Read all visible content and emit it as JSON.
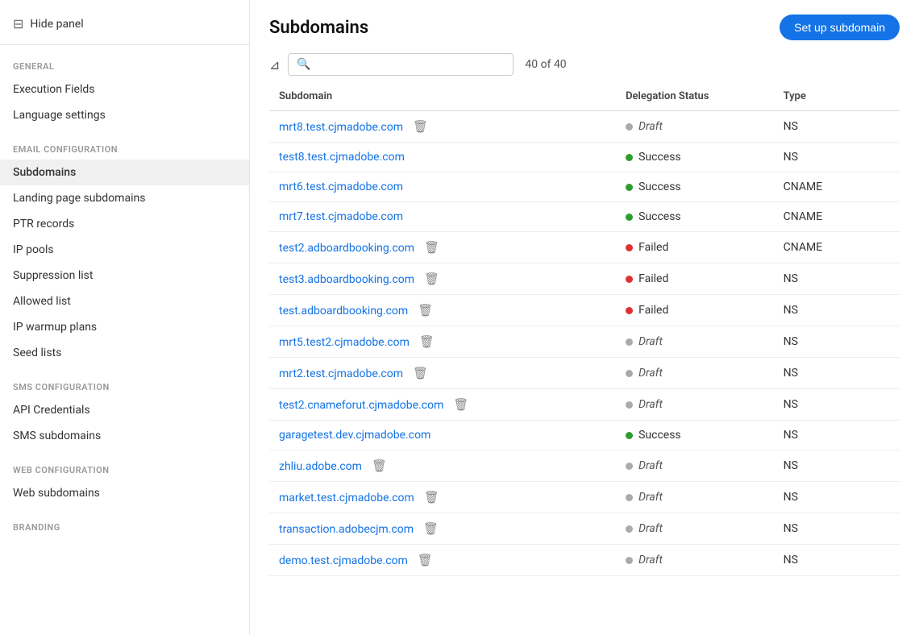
{
  "sidebar": {
    "hide_panel_label": "Hide panel",
    "sections": [
      {
        "label": "GENERAL",
        "items": [
          {
            "id": "execution-fields",
            "label": "Execution Fields",
            "active": false
          },
          {
            "id": "language-settings",
            "label": "Language settings",
            "active": false
          }
        ]
      },
      {
        "label": "EMAIL CONFIGURATION",
        "items": [
          {
            "id": "subdomains",
            "label": "Subdomains",
            "active": true
          },
          {
            "id": "landing-page-subdomains",
            "label": "Landing page subdomains",
            "active": false
          },
          {
            "id": "ptr-records",
            "label": "PTR records",
            "active": false
          },
          {
            "id": "ip-pools",
            "label": "IP pools",
            "active": false
          },
          {
            "id": "suppression-list",
            "label": "Suppression list",
            "active": false
          },
          {
            "id": "allowed-list",
            "label": "Allowed list",
            "active": false
          },
          {
            "id": "ip-warmup-plans",
            "label": "IP warmup plans",
            "active": false
          },
          {
            "id": "seed-lists",
            "label": "Seed lists",
            "active": false
          }
        ]
      },
      {
        "label": "SMS CONFIGURATION",
        "items": [
          {
            "id": "api-credentials",
            "label": "API Credentials",
            "active": false
          },
          {
            "id": "sms-subdomains",
            "label": "SMS subdomains",
            "active": false
          }
        ]
      },
      {
        "label": "WEB CONFIGURATION",
        "items": [
          {
            "id": "web-subdomains",
            "label": "Web subdomains",
            "active": false
          }
        ]
      },
      {
        "label": "BRANDING",
        "items": []
      }
    ]
  },
  "main": {
    "title": "Subdomains",
    "setup_button_label": "Set up subdomain",
    "search_placeholder": "",
    "count_label": "40 of 40",
    "table": {
      "columns": [
        "Subdomain",
        "Delegation Status",
        "Type"
      ],
      "rows": [
        {
          "subdomain": "mrt8.test.cjmadobe.com",
          "has_delete": true,
          "status": "Draft",
          "status_type": "draft",
          "type": "NS"
        },
        {
          "subdomain": "test8.test.cjmadobe.com",
          "has_delete": false,
          "status": "Success",
          "status_type": "success",
          "type": "NS"
        },
        {
          "subdomain": "mrt6.test.cjmadobe.com",
          "has_delete": false,
          "status": "Success",
          "status_type": "success",
          "type": "CNAME"
        },
        {
          "subdomain": "mrt7.test.cjmadobe.com",
          "has_delete": false,
          "status": "Success",
          "status_type": "success",
          "type": "CNAME"
        },
        {
          "subdomain": "test2.adboardbooking.com",
          "has_delete": true,
          "status": "Failed",
          "status_type": "failed",
          "type": "CNAME"
        },
        {
          "subdomain": "test3.adboardbooking.com",
          "has_delete": true,
          "status": "Failed",
          "status_type": "failed",
          "type": "NS"
        },
        {
          "subdomain": "test.adboardbooking.com",
          "has_delete": true,
          "status": "Failed",
          "status_type": "failed",
          "type": "NS"
        },
        {
          "subdomain": "mrt5.test2.cjmadobe.com",
          "has_delete": true,
          "status": "Draft",
          "status_type": "draft",
          "type": "NS"
        },
        {
          "subdomain": "mrt2.test.cjmadobe.com",
          "has_delete": true,
          "status": "Draft",
          "status_type": "draft",
          "type": "NS"
        },
        {
          "subdomain": "test2.cnameforut.cjmadobe.com",
          "has_delete": true,
          "status": "Draft",
          "status_type": "draft",
          "type": "NS"
        },
        {
          "subdomain": "garagetest.dev.cjmadobe.com",
          "has_delete": false,
          "status": "Success",
          "status_type": "success",
          "type": "NS"
        },
        {
          "subdomain": "zhliu.adobe.com",
          "has_delete": true,
          "status": "Draft",
          "status_type": "draft",
          "type": "NS"
        },
        {
          "subdomain": "market.test.cjmadobe.com",
          "has_delete": true,
          "status": "Draft",
          "status_type": "draft",
          "type": "NS"
        },
        {
          "subdomain": "transaction.adobecjm.com",
          "has_delete": true,
          "status": "Draft",
          "status_type": "draft",
          "type": "NS"
        },
        {
          "subdomain": "demo.test.cjmadobe.com",
          "has_delete": true,
          "status": "Draft",
          "status_type": "draft",
          "type": "NS"
        }
      ]
    }
  }
}
